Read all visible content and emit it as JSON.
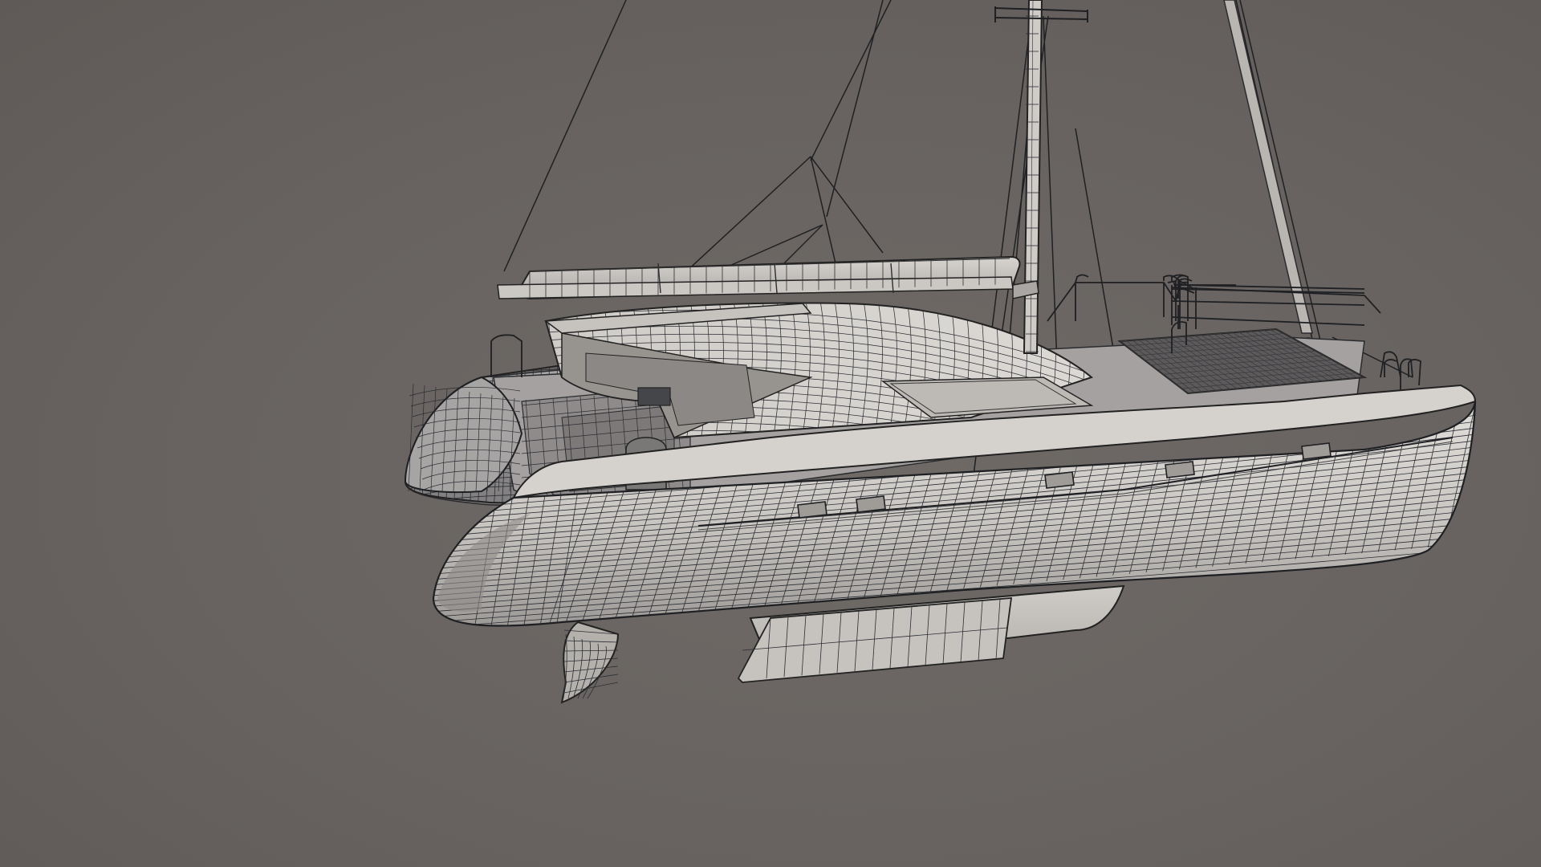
{
  "scene": {
    "subject": "catamaran-wireframe-render",
    "colors": {
      "background": "#6b6662",
      "hull_light": "#d9d6d2",
      "hull_mid": "#b9b6b2",
      "hull_shadow": "#8f8c8a",
      "wire": "#2b2d33",
      "rigging": "#1e1f22"
    }
  }
}
